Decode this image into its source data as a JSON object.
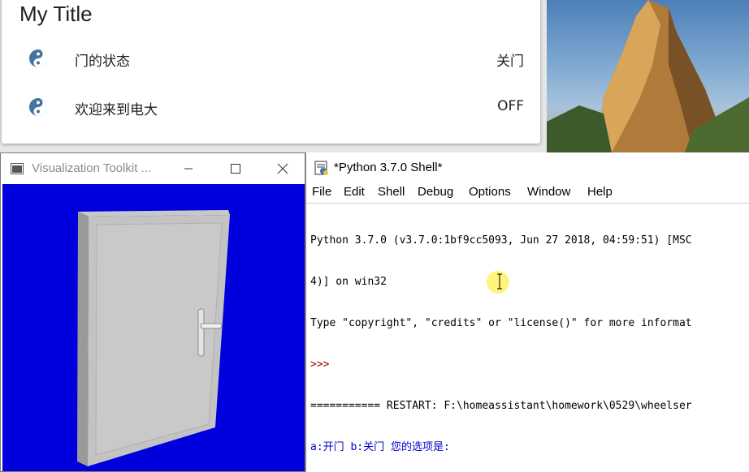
{
  "ha_card": {
    "title": "My Title",
    "rows": [
      {
        "icon": "yin-yang-icon",
        "name": "门的状态",
        "state": "关门"
      },
      {
        "icon": "yin-yang-icon",
        "name": "欢迎来到电大",
        "state": "OFF"
      }
    ]
  },
  "vtk_window": {
    "title": "Visualization Toolkit ...",
    "background_color": "#0000dd"
  },
  "python_shell": {
    "title": "*Python 3.7.0 Shell*",
    "menu": [
      "File",
      "Edit",
      "Shell",
      "Debug",
      "Options",
      "Window",
      "Help"
    ],
    "lines": [
      "Python 3.7.0 (v3.7.0:1bf9cc5093, Jun 27 2018, 04:59:51) [MSC",
      "4)] on win32",
      "Type \"copyright\", \"credits\" or \"license()\" for more informat",
      ">>> ",
      "=========== RESTART: F:\\homeassistant\\homework\\0529\\wheelser",
      "a:开门 b:关门 您的选项是: "
    ]
  },
  "colors": {
    "ha_icon": "#44739e",
    "prompt": "#a00000",
    "program_output": "#0000cc"
  }
}
